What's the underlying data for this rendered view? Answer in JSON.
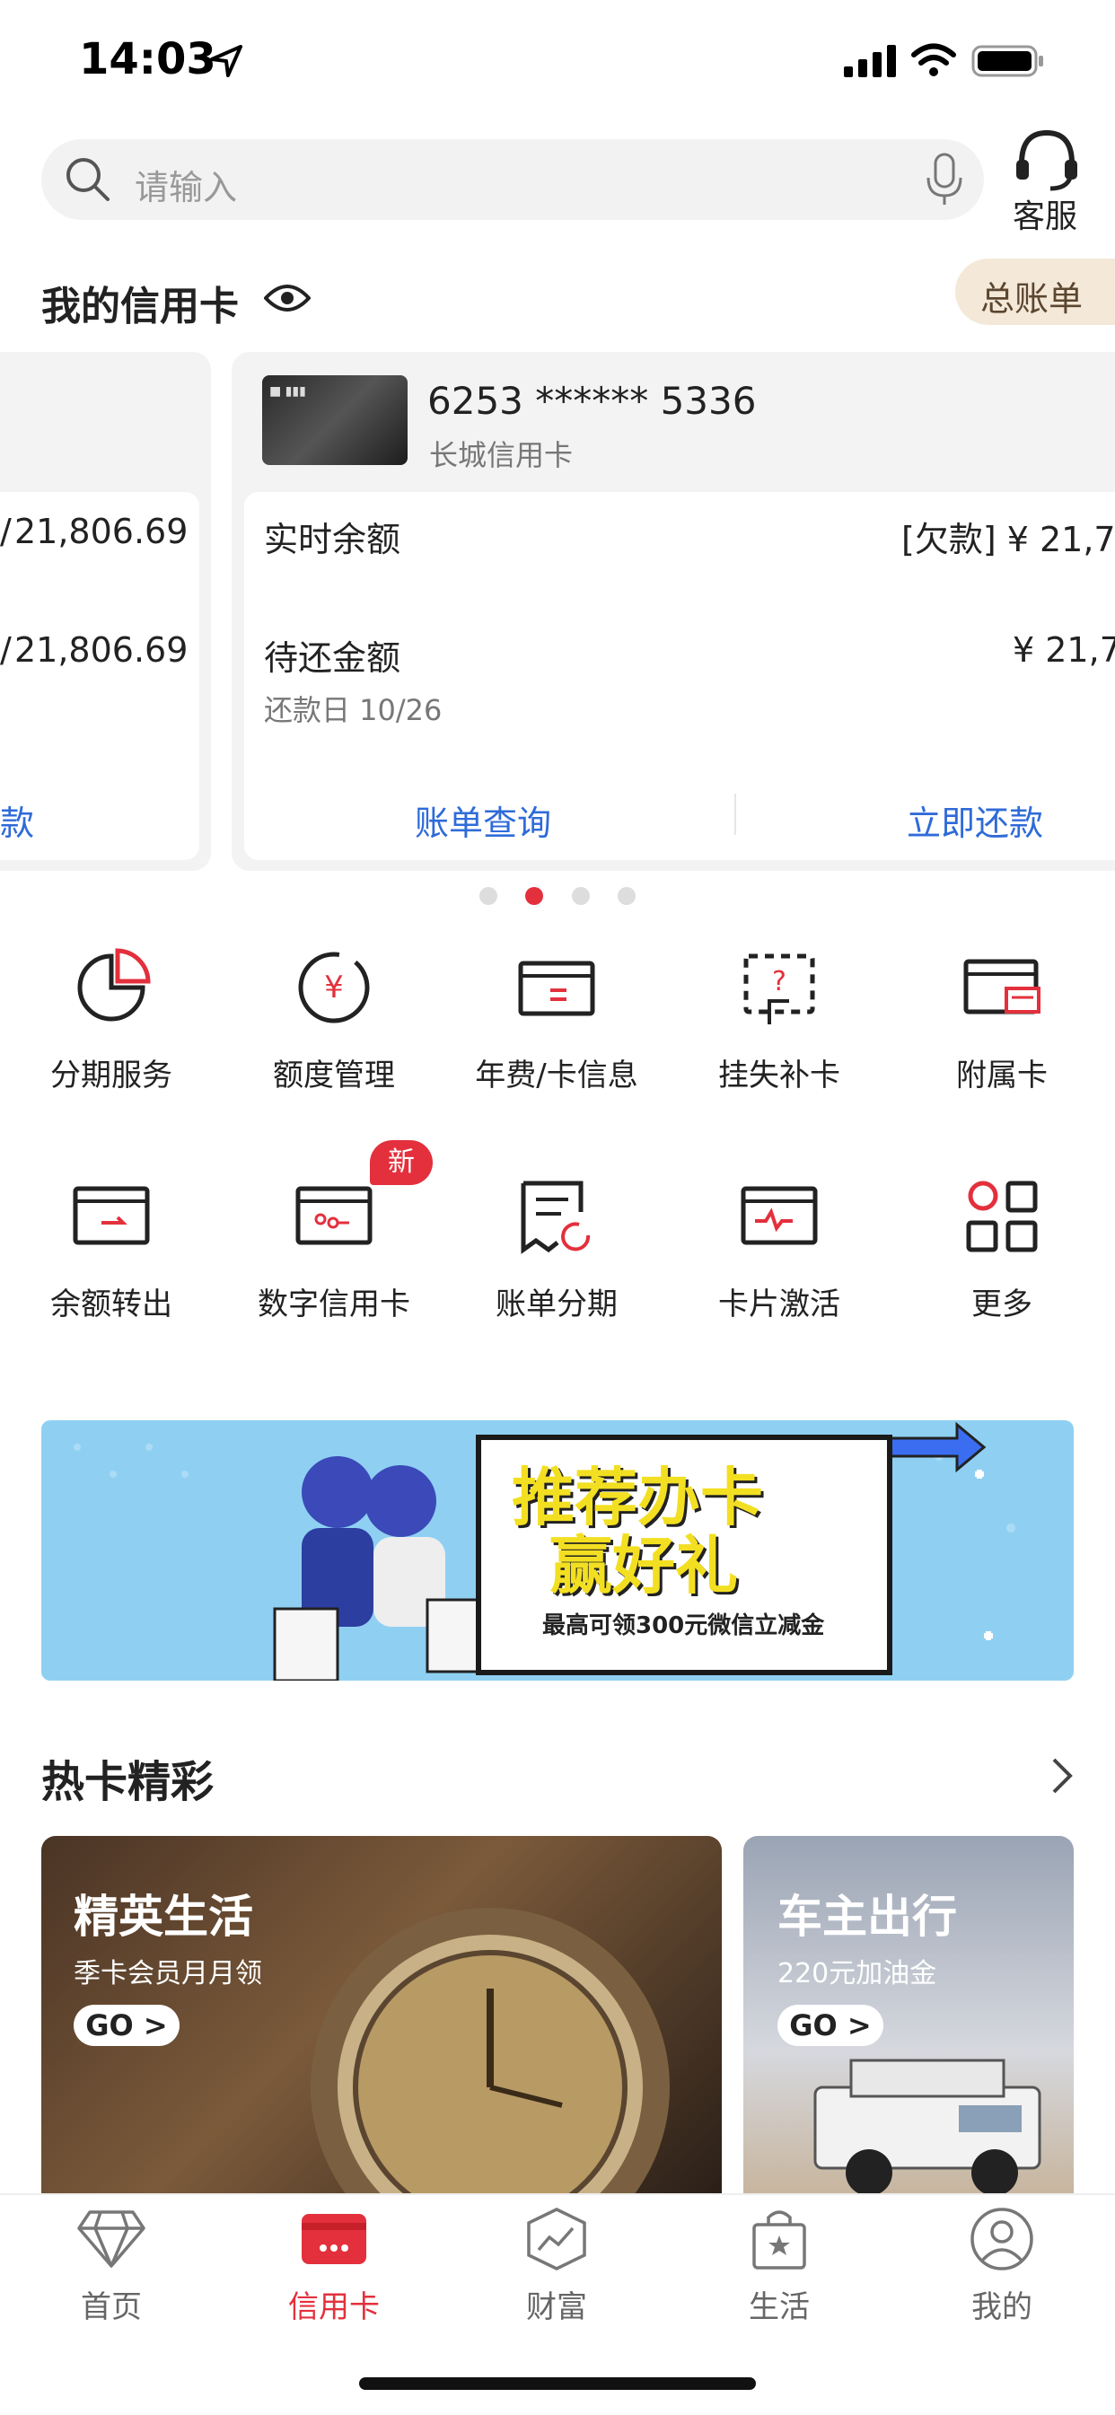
{
  "status_bar": {
    "time": "14:03"
  },
  "search": {
    "placeholder": "请输入"
  },
  "header_actions": {
    "service_label": "客服"
  },
  "section": {
    "title": "我的信用卡",
    "bill_button": "总账单"
  },
  "cards": [
    {
      "number": "6253 ****** 5336",
      "name": "长城信用卡",
      "realtime_balance_label": "实时余额",
      "realtime_balance_value": "[欠款] ¥ 21,7",
      "due_amount_label": "待还金额",
      "due_amount_value": "¥ 21,7",
      "due_date": "还款日 10/26",
      "action_bill": "账单查询",
      "action_repay": "立即还款"
    }
  ],
  "prev_card": {
    "value1": "21,806.69",
    "value2": "21,806.69",
    "partial_action": "款"
  },
  "pager": {
    "count": 4,
    "active_index": 1
  },
  "services": [
    {
      "label": "分期服务",
      "icon": "pie-chart-icon"
    },
    {
      "label": "额度管理",
      "icon": "yuan-circle-icon"
    },
    {
      "label": "年费/卡信息",
      "icon": "card-info-icon"
    },
    {
      "label": "挂失补卡",
      "icon": "card-lost-icon"
    },
    {
      "label": "附属卡",
      "icon": "supplementary-card-icon"
    },
    {
      "label": "余额转出",
      "icon": "balance-transfer-icon"
    },
    {
      "label": "数字信用卡",
      "icon": "digital-card-icon",
      "badge": "新"
    },
    {
      "label": "账单分期",
      "icon": "bill-installment-icon"
    },
    {
      "label": "卡片激活",
      "icon": "card-activate-icon"
    },
    {
      "label": "更多",
      "icon": "more-grid-icon"
    }
  ],
  "banner": {
    "title_line1": "推荐办卡",
    "title_line2": "赢好礼",
    "subtitle": "最高可领300元微信立减金"
  },
  "hot_cards": {
    "title": "热卡精彩",
    "items": [
      {
        "title": "精英生活",
        "subtitle": "季卡会员月月领",
        "button": "GO >"
      },
      {
        "title": "车主出行",
        "subtitle": "220元加油金",
        "button": "GO >"
      }
    ]
  },
  "tabs": [
    {
      "label": "首页",
      "icon": "diamond-icon",
      "active": false
    },
    {
      "label": "信用卡",
      "icon": "credit-card-icon",
      "active": true
    },
    {
      "label": "财富",
      "icon": "wealth-chart-icon",
      "active": false
    },
    {
      "label": "生活",
      "icon": "shopping-bag-icon",
      "active": false
    },
    {
      "label": "我的",
      "icon": "user-icon",
      "active": false
    }
  ],
  "colors": {
    "accent": "#e3303c",
    "link": "#2f6bd8",
    "badge_bg": "#f4e8d8"
  }
}
